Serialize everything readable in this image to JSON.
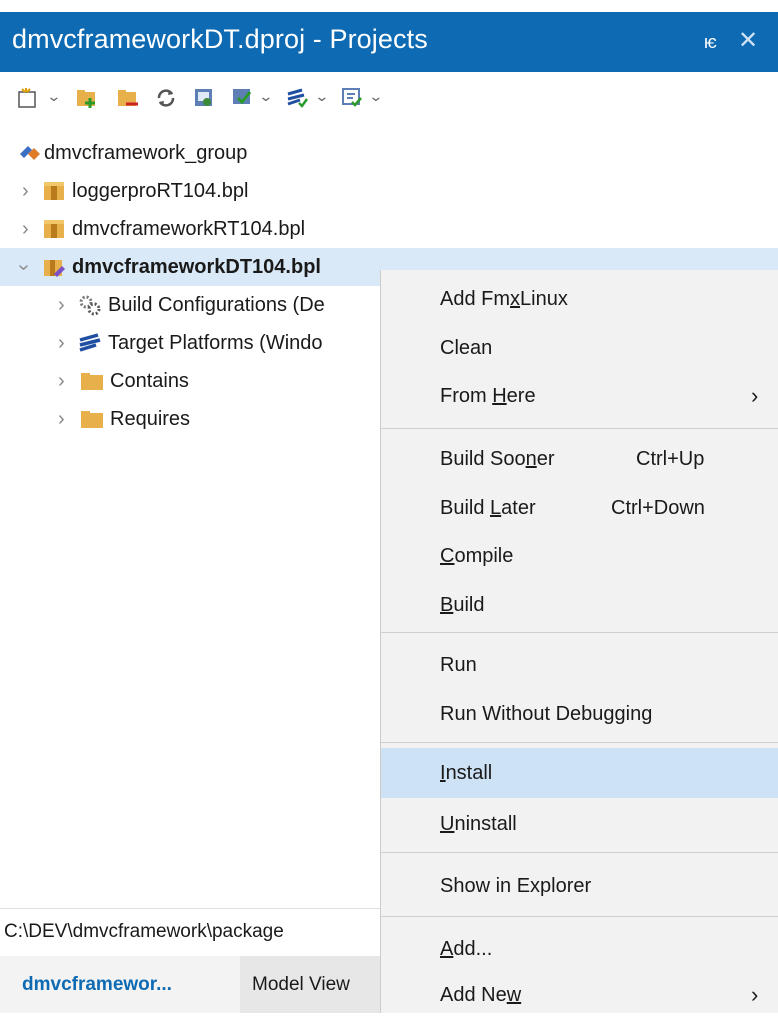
{
  "title": "dmvcframeworkDT.dproj - Projects",
  "window_controls": {
    "pin": "ѥ",
    "close": "✕"
  },
  "toolbar": {
    "icons": [
      "new-item-icon",
      "add-file-icon",
      "remove-file-icon",
      "refresh-icon",
      "build-icon",
      "compile-icon",
      "build-all-icon",
      "activate-icon"
    ]
  },
  "tree": [
    {
      "label": "dmvcframework_group",
      "type": "group"
    },
    {
      "label": "loggerproRT104.bpl",
      "type": "package"
    },
    {
      "label": "dmvcframeworkRT104.bpl",
      "type": "package"
    },
    {
      "label": "dmvcframeworkDT104.bpl",
      "type": "package-active"
    },
    {
      "label": "Build Configurations (De",
      "type": "config"
    },
    {
      "label": "Target Platforms (Windo",
      "type": "platforms"
    },
    {
      "label": "Contains",
      "type": "folder"
    },
    {
      "label": "Requires",
      "type": "folder"
    }
  ],
  "path": "C:\\DEV\\dmvcframework\\package",
  "tabs": [
    {
      "label": "dmvcframewor...",
      "active": true
    },
    {
      "label": "Model View",
      "active": false
    }
  ],
  "context_menu": {
    "add_fmxlinux": {
      "pre": "Add Fm",
      "u": "x",
      "post": "Linux"
    },
    "clean": "Clean",
    "from_here": {
      "pre": "From ",
      "u": "H",
      "post": "ere"
    },
    "build_sooner": {
      "pre": "Build Soo",
      "u": "n",
      "post": "er",
      "shortcut": "Ctrl+Up"
    },
    "build_later": {
      "pre": "Build ",
      "u": "L",
      "post": "ater",
      "shortcut": "Ctrl+Down"
    },
    "compile": {
      "u": "C",
      "post": "ompile"
    },
    "build": {
      "u": "B",
      "post": "uild"
    },
    "run": "Run",
    "run_without_debugging": "Run Without Debugging",
    "install": {
      "u": "I",
      "post": "nstall"
    },
    "uninstall": {
      "u": "U",
      "post": "ninstall"
    },
    "show_in_explorer": "Show in Explorer",
    "add": {
      "u": "A",
      "post": "dd..."
    },
    "add_new": {
      "pre": "Add Ne",
      "u": "w",
      "post": ""
    }
  },
  "colors": {
    "accent": "#0e6ab3",
    "selection": "#d9e9f7",
    "menu_highlight": "#cde2f5",
    "folder": "#e8b04a"
  }
}
